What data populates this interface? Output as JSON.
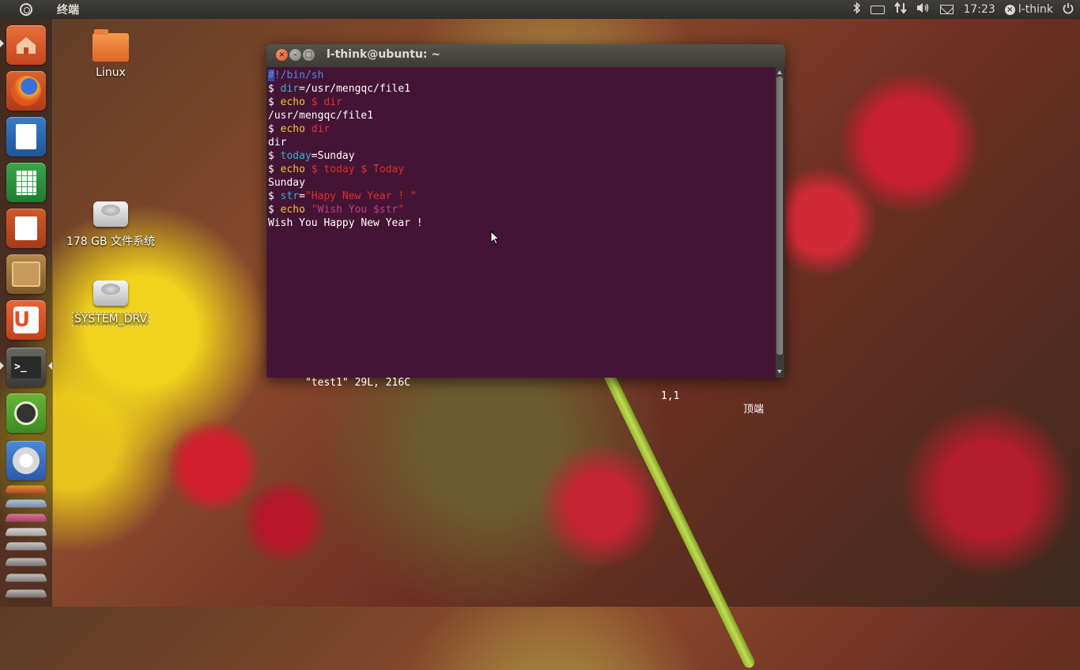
{
  "top_panel": {
    "app_title": "终端",
    "clock": "17:23",
    "user": "l-think"
  },
  "desktop": {
    "icons": [
      {
        "label": "Linux"
      },
      {
        "label": "178 GB 文件系统"
      },
      {
        "label": "SYSTEM_DRV"
      }
    ]
  },
  "launcher": {
    "items": [
      {
        "icon": "home-folder-icon"
      },
      {
        "icon": "firefox-icon"
      },
      {
        "icon": "writer-icon"
      },
      {
        "icon": "calc-icon"
      },
      {
        "icon": "impress-icon"
      },
      {
        "icon": "software-center-icon"
      },
      {
        "icon": "ubuntu-one-icon"
      },
      {
        "icon": "terminal-icon"
      },
      {
        "icon": "workspaces-icon"
      },
      {
        "icon": "chromium-icon"
      }
    ]
  },
  "terminal": {
    "title": "l-think@ubuntu: ~",
    "lines": {
      "l1_hash": "#",
      "l1_rest": "!/bin/sh",
      "l2_prompt": "$ ",
      "l2_var": "dir",
      "l2_rest": "=/usr/mengqc/file1",
      "l3_prompt": "$ ",
      "l3_cmd": "echo",
      "l3_arg": " $ dir",
      "l4": "/usr/mengqc/file1",
      "l5_prompt": "$ ",
      "l5_cmd": "echo",
      "l5_arg": " dir",
      "l6": "dir",
      "l7_prompt": "$ ",
      "l7_var": "today",
      "l7_rest": "=Sunday",
      "l8_prompt": "$ ",
      "l8_cmd": "echo",
      "l8_arg": " $ today $ Today",
      "l9": "Sunday",
      "l10_prompt": "$ ",
      "l10_var": "str",
      "l10_eq": "=",
      "l10_str": "\"Hapy New Year ! \"",
      "l11_prompt": "$ ",
      "l11_cmd": "echo",
      "l11_q1": " \"",
      "l11_body": "Wish You $str",
      "l11_q2": "\"",
      "l12": "Wish You Happy New Year !"
    },
    "status": {
      "file": "\"test1\" 29L, 216C",
      "position": "1,1",
      "scroll": "顶端"
    }
  }
}
